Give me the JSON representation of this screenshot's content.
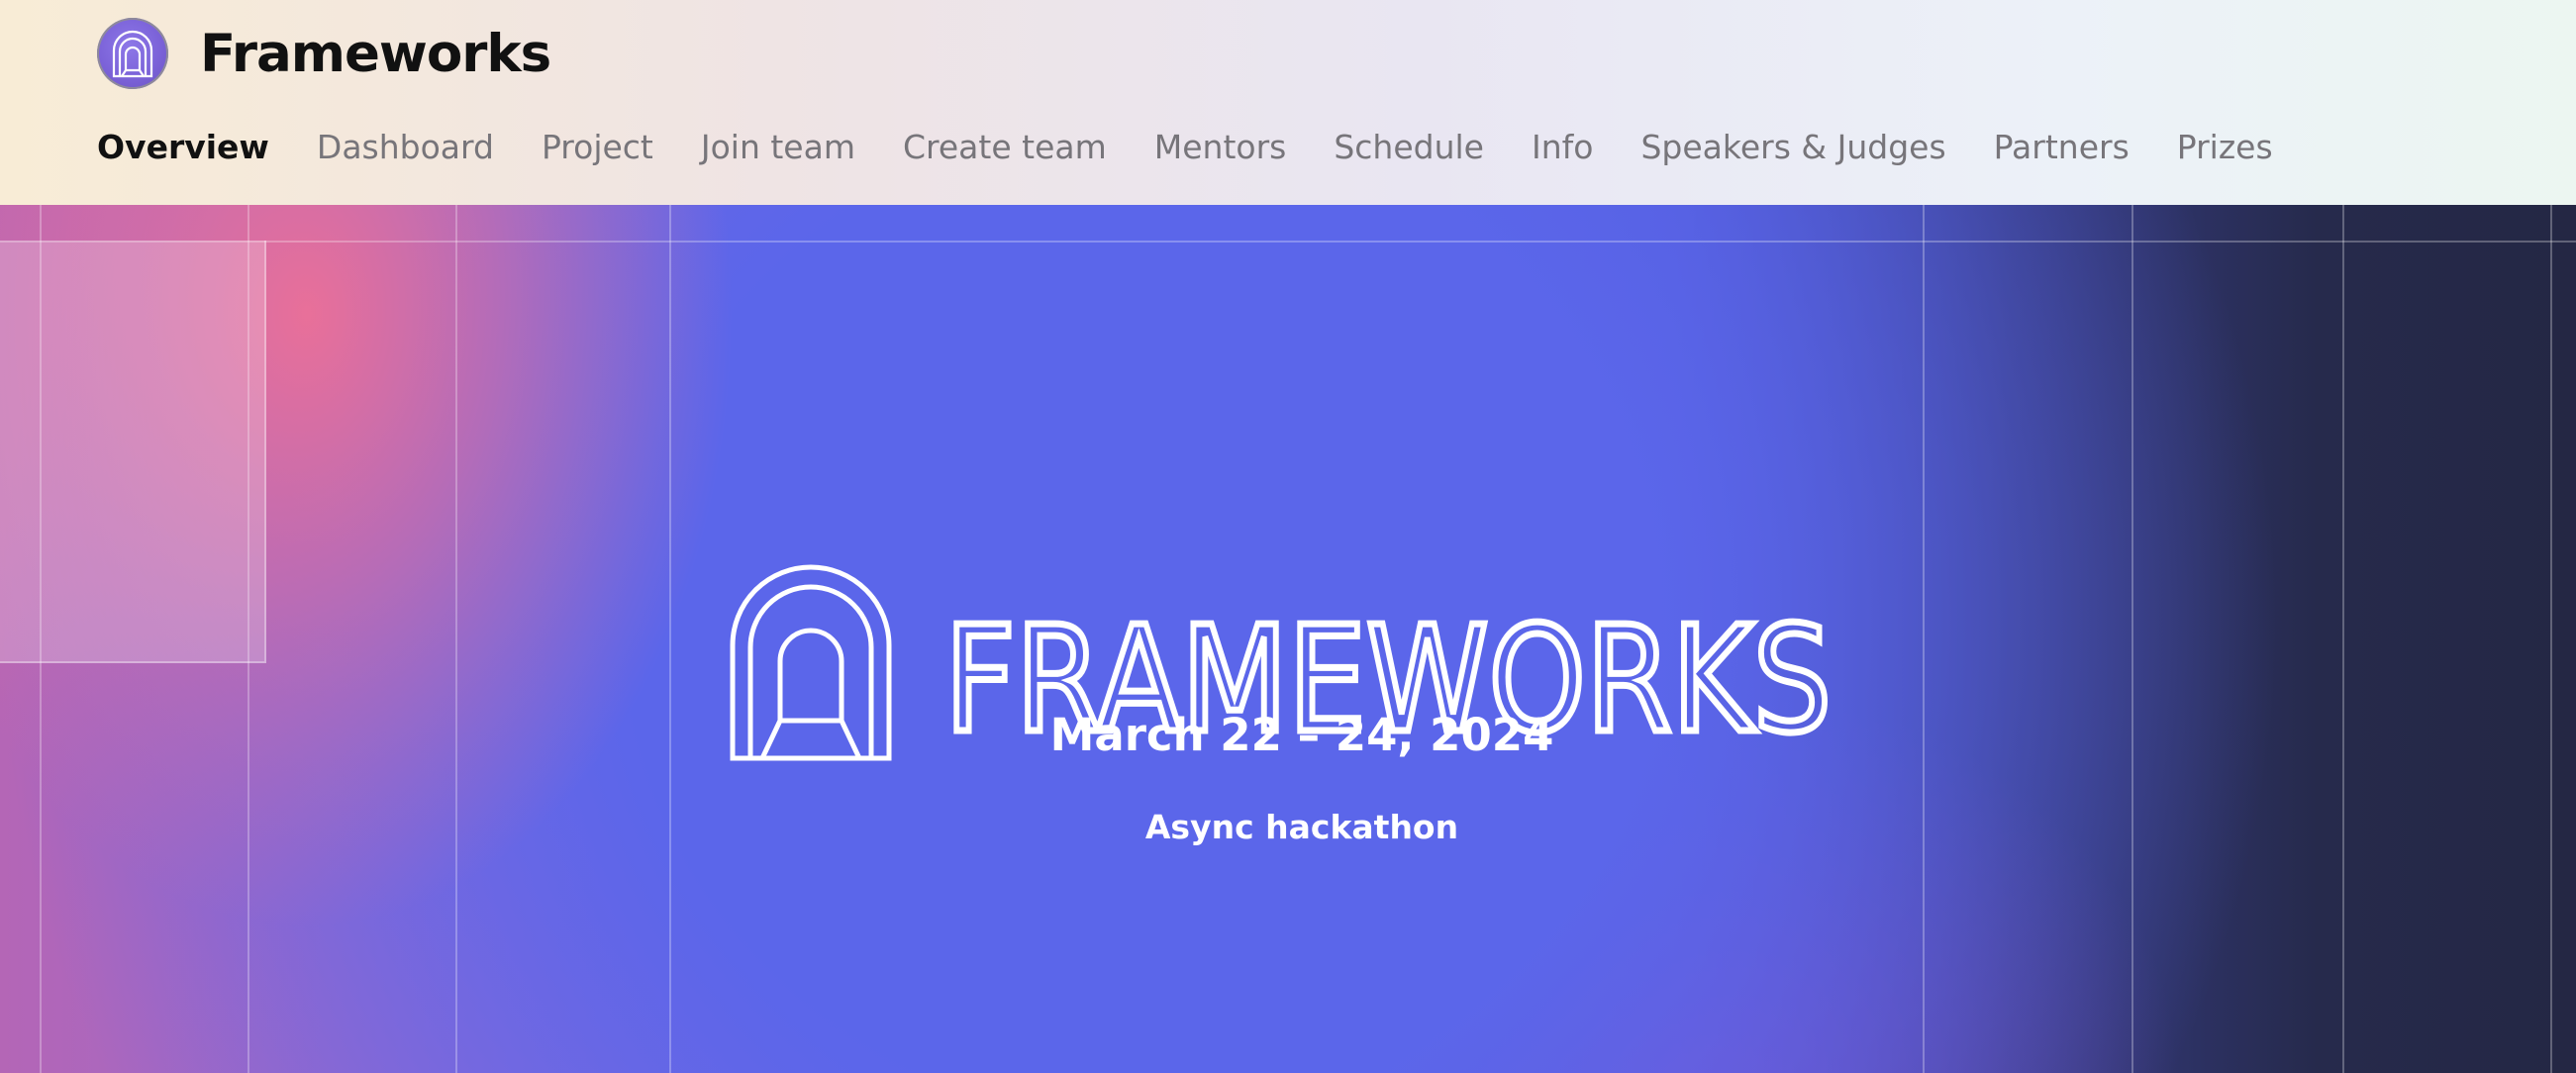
{
  "header": {
    "brand_name": "Frameworks",
    "logo_icon": "arch-tunnel-icon"
  },
  "nav": {
    "items": [
      {
        "label": "Overview",
        "active": true
      },
      {
        "label": "Dashboard",
        "active": false
      },
      {
        "label": "Project",
        "active": false
      },
      {
        "label": "Join team",
        "active": false
      },
      {
        "label": "Create team",
        "active": false
      },
      {
        "label": "Mentors",
        "active": false
      },
      {
        "label": "Schedule",
        "active": false
      },
      {
        "label": "Info",
        "active": false
      },
      {
        "label": "Speakers & Judges",
        "active": false
      },
      {
        "label": "Partners",
        "active": false
      },
      {
        "label": "Prizes",
        "active": false
      }
    ]
  },
  "hero": {
    "wordmark": "FRAMEWORKS",
    "date": "March 22 – 24, 2024",
    "subtitle": "Async hackathon",
    "mark_icon": "arch-tunnel-icon"
  },
  "colors": {
    "header_left": "#f8ecd6",
    "header_right": "#ecf6f1",
    "hero_blue": "#5b66ea",
    "hero_pink": "#ee7096",
    "hero_dark": "#242744",
    "nav_active": "#111111",
    "nav_inactive": "#77757a"
  }
}
